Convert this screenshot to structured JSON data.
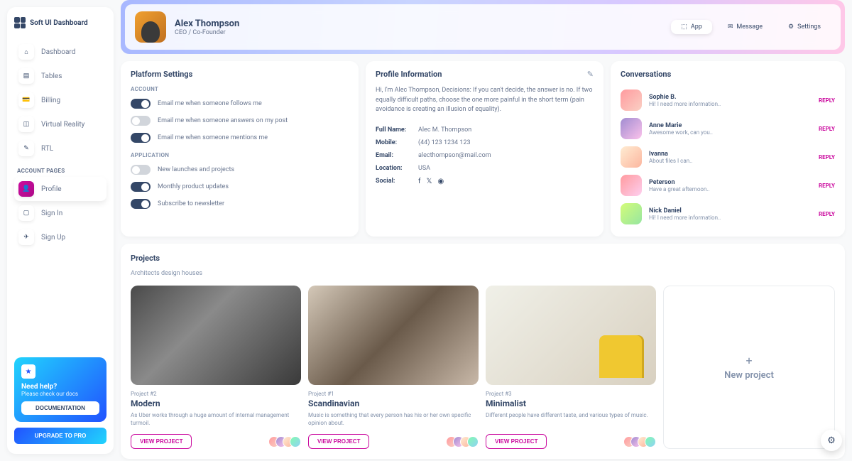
{
  "brand": "Soft UI Dashboard",
  "nav": {
    "items": [
      {
        "label": "Dashboard",
        "icon": "⌂"
      },
      {
        "label": "Tables",
        "icon": "▤"
      },
      {
        "label": "Billing",
        "icon": "💳"
      },
      {
        "label": "Virtual Reality",
        "icon": "◫"
      },
      {
        "label": "RTL",
        "icon": "✎"
      }
    ],
    "section_label": "ACCOUNT PAGES",
    "account_items": [
      {
        "label": "Profile",
        "icon": "👤"
      },
      {
        "label": "Sign In",
        "icon": "▢"
      },
      {
        "label": "Sign Up",
        "icon": "✈"
      }
    ]
  },
  "help": {
    "title": "Need help?",
    "subtitle": "Please check our docs",
    "doc_btn": "DOCUMENTATION",
    "upgrade_btn": "UPGRADE TO PRO"
  },
  "header": {
    "name": "Alex Thompson",
    "role": "CEO / Co-Founder",
    "tabs": [
      {
        "label": "App",
        "icon": "⬚"
      },
      {
        "label": "Message",
        "icon": "✉"
      },
      {
        "label": "Settings",
        "icon": "⚙"
      }
    ]
  },
  "settings": {
    "title": "Platform Settings",
    "account_label": "ACCOUNT",
    "account": [
      {
        "label": "Email me when someone follows me",
        "on": true
      },
      {
        "label": "Email me when someone answers on my post",
        "on": false
      },
      {
        "label": "Email me when someone mentions me",
        "on": true
      }
    ],
    "application_label": "APPLICATION",
    "application": [
      {
        "label": "New launches and projects",
        "on": false
      },
      {
        "label": "Monthly product updates",
        "on": true
      },
      {
        "label": "Subscribe to newsletter",
        "on": true
      }
    ]
  },
  "info": {
    "title": "Profile Information",
    "bio": "Hi, I'm Alec Thompson, Decisions: If you can't decide, the answer is no. If two equally difficult paths, choose the one more painful in the short term (pain avoidance is creating an illusion of equality).",
    "fields": {
      "fullname_label": "Full Name:",
      "fullname": "Alec M. Thompson",
      "mobile_label": "Mobile:",
      "mobile": "(44) 123 1234 123",
      "email_label": "Email:",
      "email": "alecthompson@mail.com",
      "location_label": "Location:",
      "location": "USA",
      "social_label": "Social:"
    }
  },
  "conversations": {
    "title": "Conversations",
    "reply_label": "REPLY",
    "items": [
      {
        "name": "Sophie B.",
        "msg": "Hi! I need more information.."
      },
      {
        "name": "Anne Marie",
        "msg": "Awesome work, can you.."
      },
      {
        "name": "Ivanna",
        "msg": "About files I can.."
      },
      {
        "name": "Peterson",
        "msg": "Have a great afternoon.."
      },
      {
        "name": "Nick Daniel",
        "msg": "Hi! I need more information.."
      }
    ]
  },
  "projects": {
    "title": "Projects",
    "subtitle": "Architects design houses",
    "view_label": "VIEW PROJECT",
    "new_label": "New project",
    "items": [
      {
        "num": "Project #2",
        "title": "Modern",
        "desc": "As Uber works through a huge amount of internal management turmoil."
      },
      {
        "num": "Project #1",
        "title": "Scandinavian",
        "desc": "Music is something that every person has his or her own specific opinion about."
      },
      {
        "num": "Project #3",
        "title": "Minimalist",
        "desc": "Different people have different taste, and various types of music."
      }
    ]
  }
}
